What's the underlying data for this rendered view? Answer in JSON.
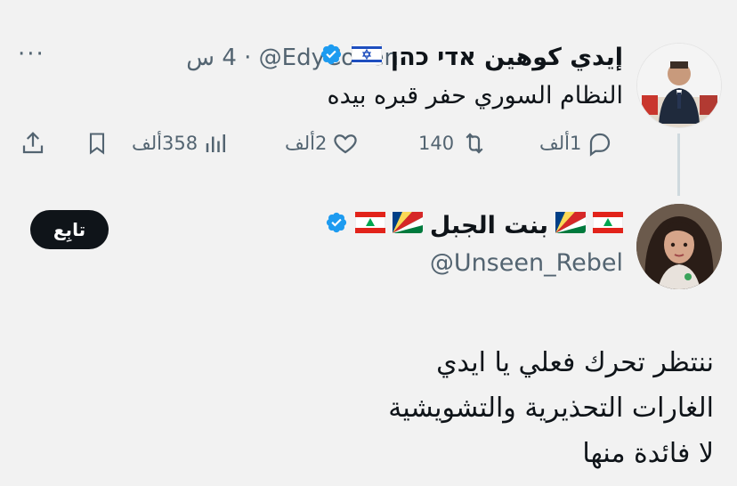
{
  "colors": {
    "background": "#f2f2f2",
    "text": "#0f1419",
    "muted": "#536471",
    "verified_blue": "#1d9bf0",
    "button_bg": "#0f1419",
    "button_text": "#ffffff"
  },
  "parent_tweet": {
    "author_name": "إيدي كوهين אדי כהן",
    "flag_icon": "israel-flag",
    "handle": "@EdyCohen",
    "separator": "·",
    "time": "4 س",
    "more_label": "···",
    "text": "النظام السوري حفر قبره بيده",
    "actions": {
      "replies": "1ألف",
      "retweets": "140",
      "likes": "2ألف",
      "views": "358ألف"
    }
  },
  "reply_tweet": {
    "author_name": "بنت الجبل",
    "flags": [
      "lebanon-flag",
      "seychelles-flag",
      "seychelles-flag",
      "lebanon-flag"
    ],
    "handle": "@Unseen_Rebel",
    "follow_label": "تابِع",
    "lines": [
      "ننتظر تحرك فعلي يا ايدي",
      "الغارات التحذيرية والتشويشية",
      "لا فائدة منها"
    ]
  }
}
